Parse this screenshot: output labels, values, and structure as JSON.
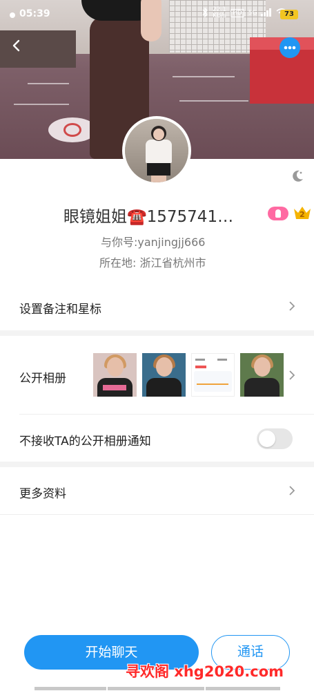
{
  "status_bar": {
    "time": "05:39",
    "net_speed_value": "22.1",
    "net_speed_unit": "KB/s",
    "hd_label": "HD",
    "signal_label": "5G",
    "battery": "73"
  },
  "profile": {
    "display_name": "眼镜姐姐☎️1575741…",
    "account_id": "与你号:yanjingjj666",
    "location": "所在地: 浙江省杭州市",
    "level_badge": "2"
  },
  "menu": {
    "remark_label": "设置备注和星标",
    "album_label": "公开相册",
    "album_notify_label": "不接收TA的公开相册通知",
    "album_notify_on": false,
    "more_info_label": "更多资料"
  },
  "actions": {
    "chat_label": "开始聊天",
    "call_label": "通话"
  },
  "watermark": "寻欢阁 xhg2020.com",
  "colors": {
    "accent": "#2196f3",
    "badge_pink": "#ff6aa2",
    "crown_gold": "#f5b400",
    "watermark_red": "#ff2a2a"
  }
}
